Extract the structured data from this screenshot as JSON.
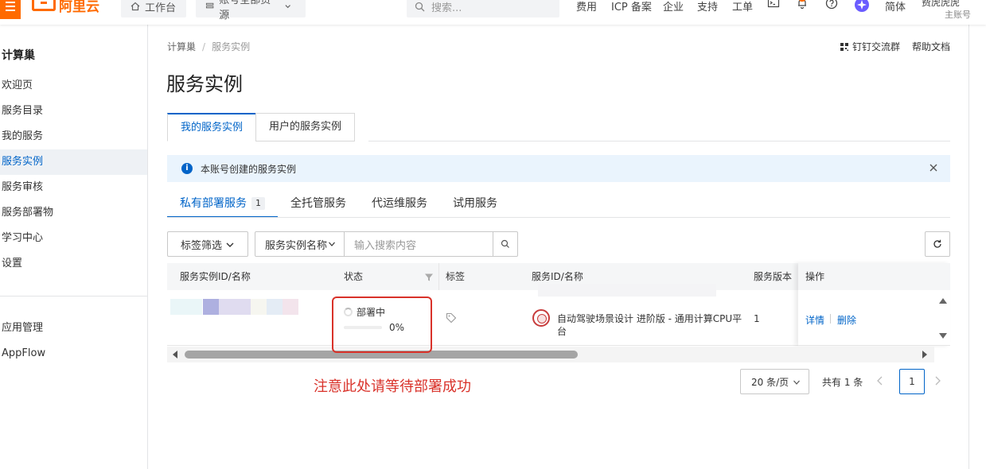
{
  "topbar": {
    "logo_text": "阿里云",
    "workbench": "工作台",
    "resource_scope": "账号全部资源",
    "search_placeholder": "搜索...",
    "nav": [
      "费用",
      "ICP 备案",
      "企业",
      "支持",
      "工单"
    ],
    "language": "简体",
    "user_name": "费虎虎虎",
    "user_role": "主账号"
  },
  "sidebar": {
    "title": "计算巢",
    "items": [
      {
        "label": "欢迎页"
      },
      {
        "label": "服务目录"
      },
      {
        "label": "我的服务"
      },
      {
        "label": "服务实例",
        "active": true
      },
      {
        "label": "服务审核"
      },
      {
        "label": "服务部署物"
      },
      {
        "label": "学习中心"
      },
      {
        "label": "设置"
      }
    ],
    "bottom_items": [
      {
        "label": "应用管理"
      },
      {
        "label": "AppFlow"
      }
    ]
  },
  "header": {
    "breadcrumb": [
      "计算巢",
      "服务实例"
    ],
    "links": [
      "钉钉交流群",
      "帮助文档"
    ],
    "title": "服务实例"
  },
  "tabs": [
    {
      "label": "我的服务实例",
      "active": true
    },
    {
      "label": "用户的服务实例"
    }
  ],
  "notice": {
    "text": "本账号创建的服务实例"
  },
  "subtabs": [
    {
      "label": "私有部署服务",
      "count": "1",
      "active": true
    },
    {
      "label": "全托管服务"
    },
    {
      "label": "代运维服务"
    },
    {
      "label": "试用服务"
    }
  ],
  "filters": {
    "tag_filter": "标签筛选",
    "field_select": "服务实例名称",
    "search_placeholder": "输入搜索内容"
  },
  "table": {
    "columns": [
      "服务实例ID/名称",
      "状态",
      "标签",
      "服务ID/名称",
      "服务版本",
      "操作"
    ],
    "rows": [
      {
        "status": "部署中",
        "progress_text": "0%",
        "progress": 0,
        "service_name": "自动驾驶场景设计 进阶版 - 通用计算CPU平台",
        "version": "1",
        "actions": [
          "详情",
          "删除"
        ]
      }
    ]
  },
  "annotation": "注意此处请等待部署成功",
  "pagination": {
    "page_size": "20 条/页",
    "total": "共有 1 条",
    "current_page": "1"
  },
  "colors": {
    "brand": "#ff6a00",
    "primary": "#0064c8",
    "annotation_red": "#d9322a"
  }
}
